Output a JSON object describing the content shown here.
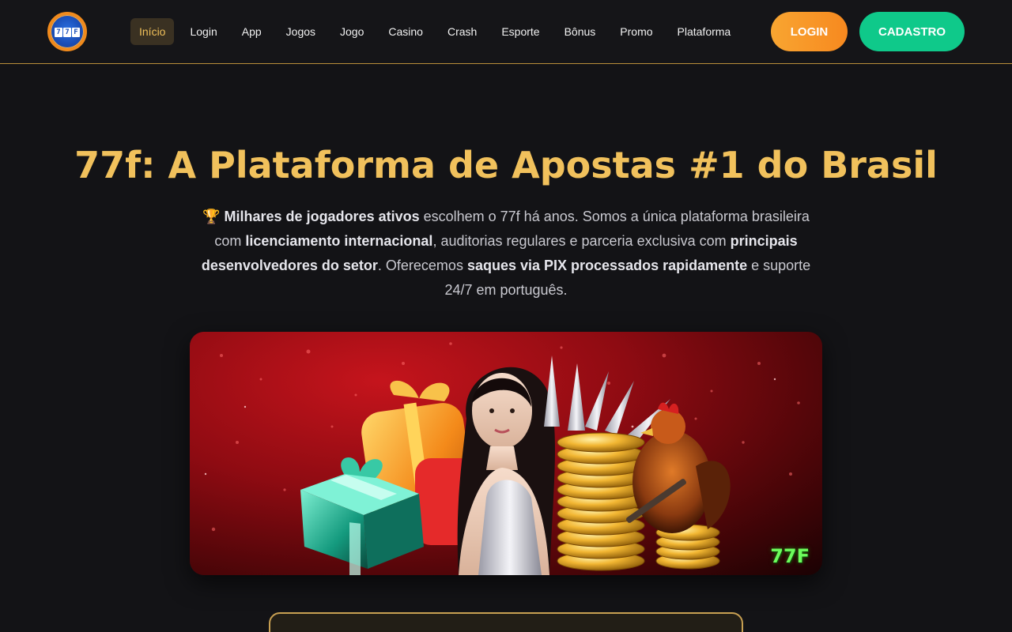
{
  "header": {
    "logo_text": "77F",
    "nav": [
      {
        "label": "Início",
        "active": true
      },
      {
        "label": "Login"
      },
      {
        "label": "App"
      },
      {
        "label": "Jogos"
      },
      {
        "label": "Jogo"
      },
      {
        "label": "Casino"
      },
      {
        "label": "Crash"
      },
      {
        "label": "Esporte"
      },
      {
        "label": "Bônus"
      },
      {
        "label": "Promo"
      },
      {
        "label": "Plataforma"
      }
    ],
    "login_label": "LOGIN",
    "signup_label": "CADASTRO"
  },
  "hero": {
    "title": "77f: A Plataforma de Apostas #1 do Brasil",
    "trophy_icon": "🏆",
    "desc_b1": "Milhares de jogadores ativos",
    "desc_t1": " escolhem o 77f há anos. Somos a única plataforma brasileira com ",
    "desc_b2": "licenciamento internacional",
    "desc_t2": ", auditorias regulares e parceria exclusiva com ",
    "desc_b3": "principais desenvolvedores do setor",
    "desc_t3": ". Oferecemos ",
    "desc_b4": "saques via PIX processados rapidamente",
    "desc_t4": " e suporte 24/7 em português."
  },
  "banner": {
    "tag": "77F"
  },
  "colors": {
    "accent_gold": "#f1c15c",
    "login_orange": "#f7891f",
    "signup_green": "#0fc98a",
    "background": "#131316"
  }
}
